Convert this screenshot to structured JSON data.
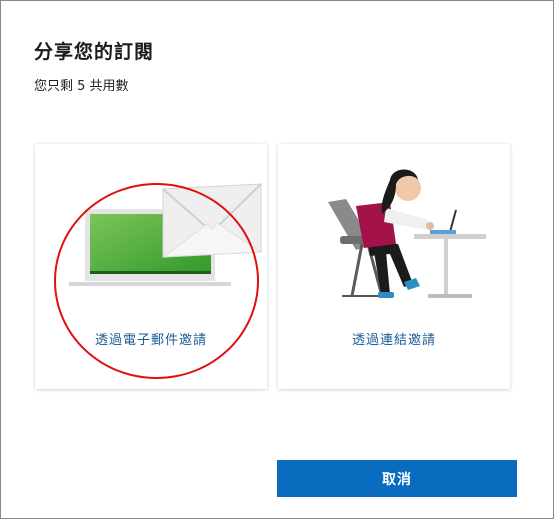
{
  "dialog": {
    "title": "分享您的訂閱",
    "subtitle": "您只剩 5 共用數"
  },
  "options": [
    {
      "label": "透過電子郵件邀請",
      "illustration": "laptop-envelope-illustration"
    },
    {
      "label": "透過連結邀請",
      "illustration": "person-at-laptop-illustration"
    }
  ],
  "actions": {
    "cancel_label": "取消"
  },
  "colors": {
    "accent": "#0a6cbe",
    "link_text": "#1a5e9a",
    "annotation_circle": "#e01010",
    "screen_green": "#4fa83a",
    "shirt": "#a3134a"
  }
}
